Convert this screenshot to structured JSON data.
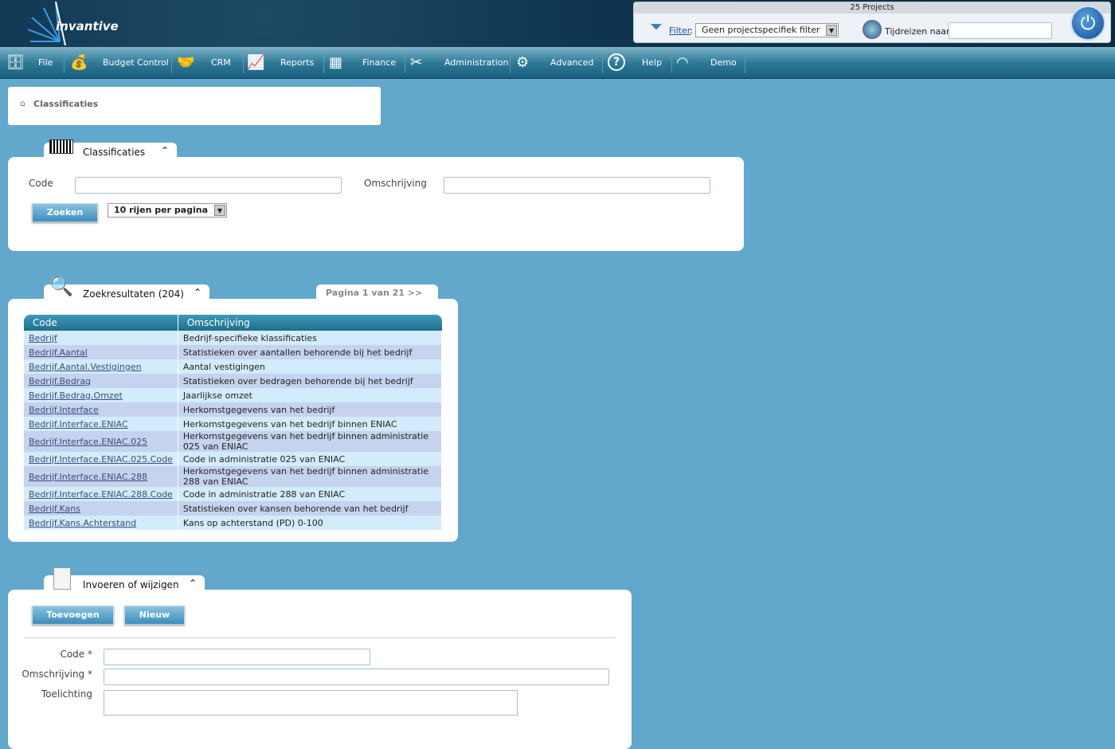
{
  "brand": {
    "name": "invantive"
  },
  "project_bar": {
    "count_label": "25 Projects",
    "filter_link": "Filter",
    "filter_value": "Geen projectspecifiek filter",
    "time_travel_label": "Tijdreizen naar:",
    "time_travel_value": ""
  },
  "nav": [
    {
      "label": "File",
      "icon": "cabinet-icon"
    },
    {
      "label": "Budget Control",
      "icon": "money-bag-icon"
    },
    {
      "label": "CRM",
      "icon": "handshake-icon"
    },
    {
      "label": "Reports",
      "icon": "presentation-icon"
    },
    {
      "label": "Finance",
      "icon": "calculator-icon"
    },
    {
      "label": "Administration",
      "icon": "tools-icon"
    },
    {
      "label": "Advanced",
      "icon": "gears-icon"
    },
    {
      "label": "Help",
      "icon": "help-icon"
    },
    {
      "label": "Demo",
      "icon": "demo-logo-icon"
    }
  ],
  "breadcrumb": {
    "label": "Classificaties"
  },
  "search": {
    "title": "Classificaties",
    "code_label": "Code",
    "code_value": "",
    "desc_label": "Omschrijving",
    "desc_value": "",
    "search_button": "Zoeken",
    "rows_per_page": "10 rijen per pagina"
  },
  "results": {
    "title": "Zoekresultaten (204)",
    "pagination": "Pagina 1 van 21  >>  >|",
    "columns": [
      "Code",
      "Omschrijving"
    ],
    "rows": [
      [
        "Bedrijf",
        "Bedrijf-specifieke klassificaties"
      ],
      [
        "Bedrijf.Aantal",
        "Statistieken over aantallen behorende bij het bedrijf"
      ],
      [
        "Bedrijf.Aantal.Vestigingen",
        "Aantal vestigingen"
      ],
      [
        "Bedrijf.Bedrag",
        "Statistieken over bedragen behorende bij het bedrijf"
      ],
      [
        "Bedrijf.Bedrag.Omzet",
        "Jaarlijkse omzet"
      ],
      [
        "Bedrijf.Interface",
        "Herkomstgegevens van het bedrijf"
      ],
      [
        "Bedrijf.Interface.ENIAC",
        "Herkomstgegevens van het bedrijf binnen ENIAC"
      ],
      [
        "Bedrijf.Interface.ENIAC.025",
        "Herkomstgegevens van het bedrijf binnen administratie 025 van ENIAC"
      ],
      [
        "Bedrijf.Interface.ENIAC.025.Code",
        "Code in administratie 025 van ENIAC"
      ],
      [
        "Bedrijf.Interface.ENIAC.288",
        "Herkomstgegevens van het bedrijf binnen administratie 288 van ENIAC"
      ],
      [
        "Bedrijf.Interface.ENIAC.288.Code",
        "Code in administratie 288 van ENIAC"
      ],
      [
        "Bedrijf.Kans",
        "Statistieken over kansen behorende van het bedrijf"
      ],
      [
        "Bedrijf.Kans.Achterstand",
        "Kans op achterstand (PD) 0-100"
      ]
    ]
  },
  "edit": {
    "title": "Invoeren of wijzigen",
    "add_button": "Toevoegen",
    "new_button": "Nieuw",
    "code_label": "Code *",
    "desc_label": "Omschrijving *",
    "note_label": "Toelichting"
  }
}
